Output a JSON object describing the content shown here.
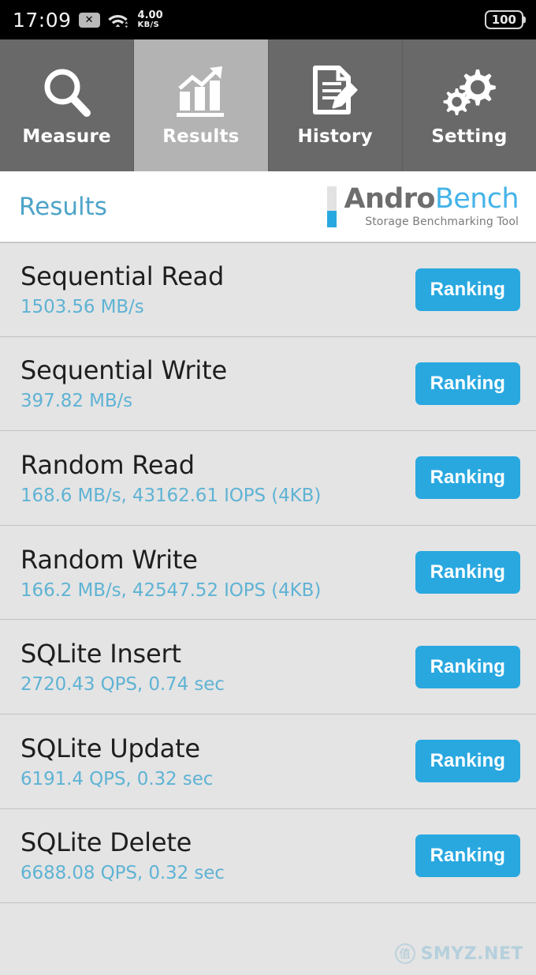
{
  "status_bar": {
    "time": "17:09",
    "sim_icon": "sim-disabled-icon",
    "wifi_icon": "wifi-icon",
    "network_speed_value": "4.00",
    "network_speed_unit": "KB/S",
    "battery_level": "100"
  },
  "tabs": [
    {
      "label": "Measure",
      "icon": "magnifier-icon",
      "active": false
    },
    {
      "label": "Results",
      "icon": "bar-chart-trend-icon",
      "active": true
    },
    {
      "label": "History",
      "icon": "document-pencil-icon",
      "active": false
    },
    {
      "label": "Setting",
      "icon": "gears-icon",
      "active": false
    }
  ],
  "header": {
    "title": "Results",
    "logo_primary": "Andro",
    "logo_secondary": "Bench",
    "logo_subtitle": "Storage Benchmarking Tool"
  },
  "results": [
    {
      "name": "Sequential Read",
      "value": "1503.56 MB/s",
      "button": "Ranking"
    },
    {
      "name": "Sequential Write",
      "value": "397.82 MB/s",
      "button": "Ranking"
    },
    {
      "name": "Random Read",
      "value": "168.6 MB/s, 43162.61 IOPS (4KB)",
      "button": "Ranking"
    },
    {
      "name": "Random Write",
      "value": "166.2 MB/s, 42547.52 IOPS (4KB)",
      "button": "Ranking"
    },
    {
      "name": "SQLite Insert",
      "value": "2720.43 QPS, 0.74 sec",
      "button": "Ranking"
    },
    {
      "name": "SQLite Update",
      "value": "6191.4 QPS, 0.32 sec",
      "button": "Ranking"
    },
    {
      "name": "SQLite Delete",
      "value": "6688.08 QPS, 0.32 sec",
      "button": "Ranking"
    }
  ],
  "watermark": {
    "badge": "值",
    "text": "SMYZ.NET"
  },
  "colors": {
    "accent_blue": "#29a8e0",
    "value_blue": "#5fb3d4",
    "title_blue": "#4ea3c8",
    "tab_inactive": "#696969",
    "tab_active": "#b3b3b3",
    "list_background": "#e4e4e4"
  }
}
